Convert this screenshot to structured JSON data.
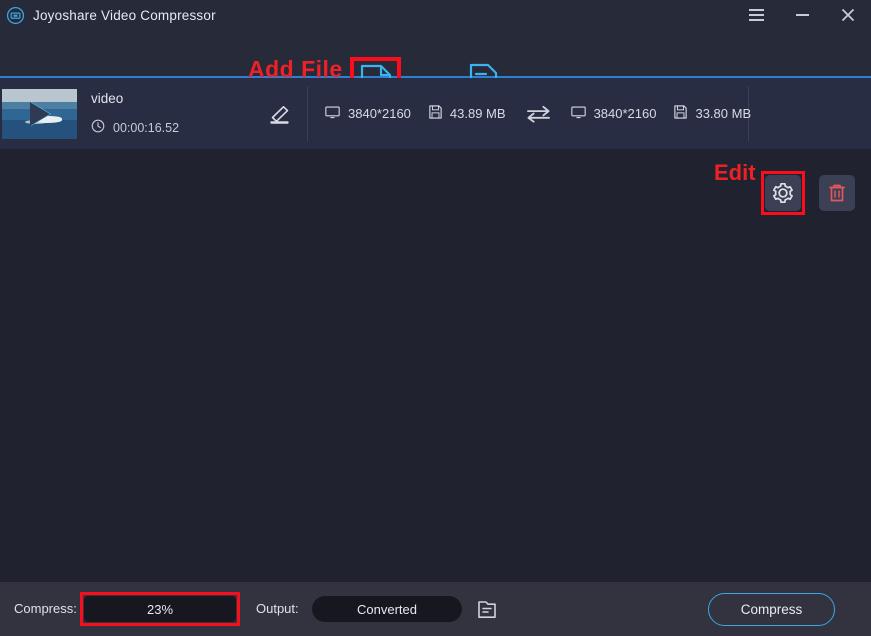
{
  "window": {
    "title": "Joyoshare Video Compressor",
    "logo_icon": "app-logo-icon",
    "menu_icon": "hamburger-menu-icon",
    "minimize_icon": "minimize-icon",
    "close_icon": "close-icon"
  },
  "toolbar": {
    "add_file_annotation": "Add File",
    "add_file_icon": "add-file-icon",
    "history_icon": "history-document-icon"
  },
  "file_row": {
    "thumbnail_icon": "video-thumbnail-play-icon",
    "name": "video",
    "clock_icon": "clock-icon",
    "duration": "00:00:16.52",
    "rename_icon": "pencil-edit-icon",
    "source": {
      "monitor_icon": "monitor-icon",
      "resolution": "3840*2160",
      "disk_icon": "disk-icon",
      "size": "43.89 MB"
    },
    "swap_icon": "swap-arrows-icon",
    "target": {
      "monitor_icon": "monitor-icon",
      "resolution": "3840*2160",
      "disk_icon": "disk-icon",
      "size": "33.80 MB"
    },
    "edit_annotation": "Edit",
    "settings_icon": "gear-settings-icon",
    "delete_icon": "trash-delete-icon"
  },
  "bottom_bar": {
    "compress_label": "Compress:",
    "compress_value": "23%",
    "output_label": "Output:",
    "output_value": "Converted",
    "folder_icon": "output-folder-icon",
    "compress_button": "Compress"
  },
  "colors": {
    "annotation_red": "#ee2127",
    "highlight_border": "#fc0d1b",
    "accent_blue": "#3aa7e8",
    "divider_blue": "#2f7fd0",
    "titlebar_bg": "#262a39",
    "row_bg": "#282d43",
    "main_bg": "#20222f",
    "bottom_bg": "#32333f"
  }
}
